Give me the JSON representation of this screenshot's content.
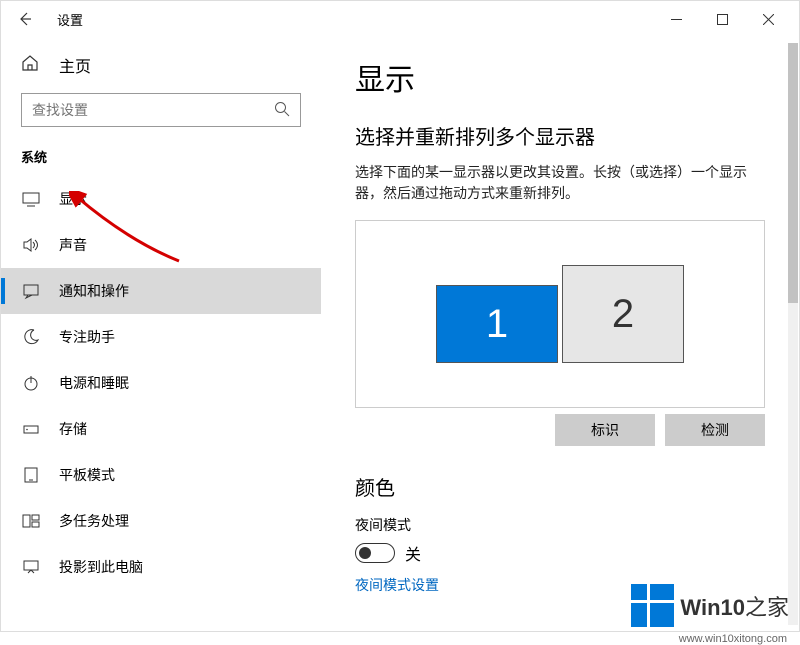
{
  "titlebar": {
    "app_name": "设置"
  },
  "sidebar": {
    "home_label": "主页",
    "search_placeholder": "查找设置",
    "group_label": "系统",
    "items": [
      {
        "label": "显示"
      },
      {
        "label": "声音"
      },
      {
        "label": "通知和操作"
      },
      {
        "label": "专注助手"
      },
      {
        "label": "电源和睡眠"
      },
      {
        "label": "存储"
      },
      {
        "label": "平板模式"
      },
      {
        "label": "多任务处理"
      },
      {
        "label": "投影到此电脑"
      }
    ]
  },
  "main": {
    "title": "显示",
    "arrange_title": "选择并重新排列多个显示器",
    "arrange_desc": "选择下面的某一显示器以更改其设置。长按（或选择）一个显示器，然后通过拖动方式来重新排列。",
    "monitor1": "1",
    "monitor2": "2",
    "identify_btn": "标识",
    "detect_btn": "检测",
    "color_title": "颜色",
    "night_light_label": "夜间模式",
    "night_light_state": "关",
    "night_light_link": "夜间模式设置"
  },
  "watermark": {
    "brand": "Win10",
    "suffix": "之家",
    "url": "www.win10xitong.com"
  }
}
